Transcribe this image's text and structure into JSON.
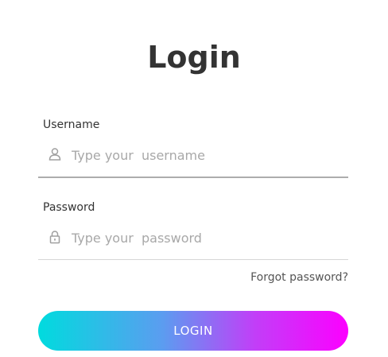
{
  "form": {
    "title": "Login",
    "username": {
      "label": "Username",
      "placeholder": "Type your  username",
      "value": "",
      "icon": "user-icon"
    },
    "password": {
      "label": "Password",
      "placeholder": "Type your  password",
      "value": "",
      "icon": "lock-icon"
    },
    "forgot_password": "Forgot password?",
    "login_button": "LOGIN"
  },
  "colors": {
    "title": "#333333",
    "gradient_start": "#00dbde",
    "gradient_end": "#fc00ff",
    "placeholder": "#a8a8a8"
  }
}
